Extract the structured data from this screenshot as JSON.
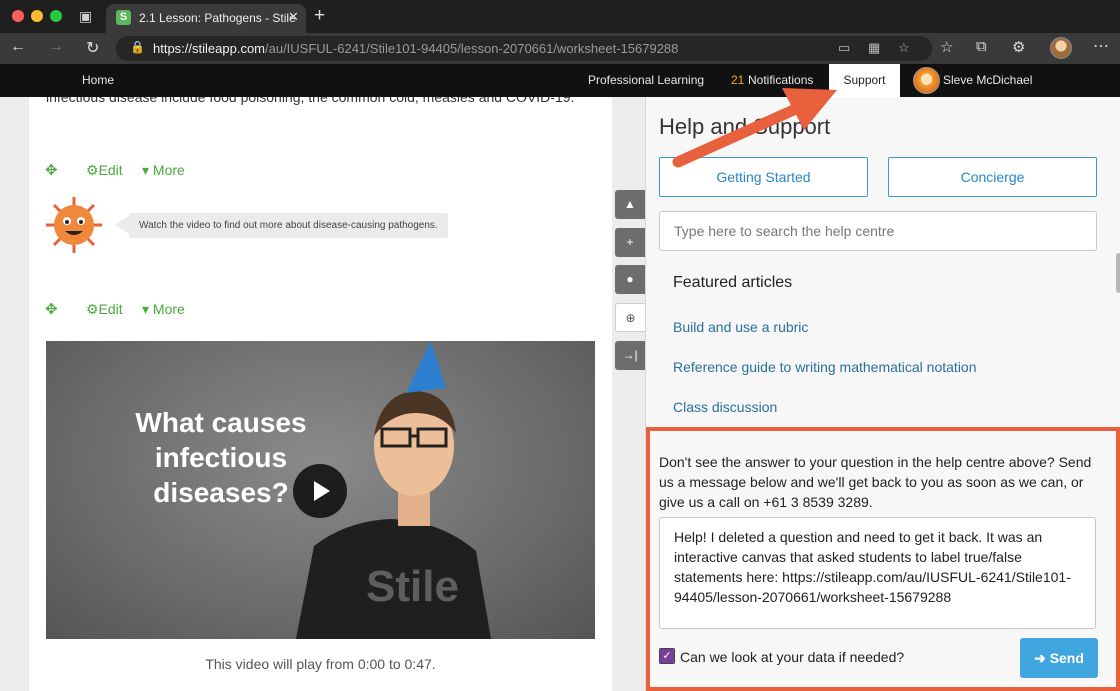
{
  "browser": {
    "tab_title": "2.1 Lesson: Pathogens - Stile",
    "favicon_letter": "S",
    "url_host": "https://stileapp.com",
    "url_path": "/au/IUSFUL-6241/Stile101-94405/lesson-2070661/worksheet-15679288"
  },
  "nav": {
    "home": "Home",
    "professional_learning": "Professional Learning",
    "notification_count": "21",
    "notifications": "Notifications",
    "support": "Support",
    "user_name": "Sleve McDichael"
  },
  "lesson": {
    "intro_text": "infectious disease include food poisoning, the common cold, measles and COVID-19.",
    "edit_label": "Edit",
    "more_label": "More",
    "bubble_text": "Watch the video to find out more about disease-causing pathogens.",
    "video_title": "What causes infectious diseases?",
    "video_caption": "This video will play from 0:00 to 0:47."
  },
  "support": {
    "title": "Help and Support",
    "getting_started": "Getting Started",
    "concierge": "Concierge",
    "search_placeholder": "Type here to search the help centre",
    "featured_title": "Featured articles",
    "articles": [
      "Build and use a rubric",
      "Reference guide to writing mathematical notation",
      "Class discussion"
    ],
    "contact_text": "Don't see the answer to your question in the help centre above? Send us a message below and we'll get back to you as soon as we can, or give us a call on +61 3 8539 3289.",
    "message": "Help! I deleted a question and need to get it back. It was an interactive canvas that asked students to label true/false statements here: https://stileapp.com/au/IUSFUL-6241/Stile101-94405/lesson-2070661/worksheet-15679288",
    "consent_label": "Can we look at your data if needed?",
    "consent_checked": true,
    "send_label": "Send"
  },
  "colors": {
    "accent_green": "#4aaa3c",
    "link_blue": "#2a6f9e",
    "button_blue": "#3fa6e0",
    "highlight_orange": "#e8603c",
    "notification_orange": "#f0a830"
  }
}
